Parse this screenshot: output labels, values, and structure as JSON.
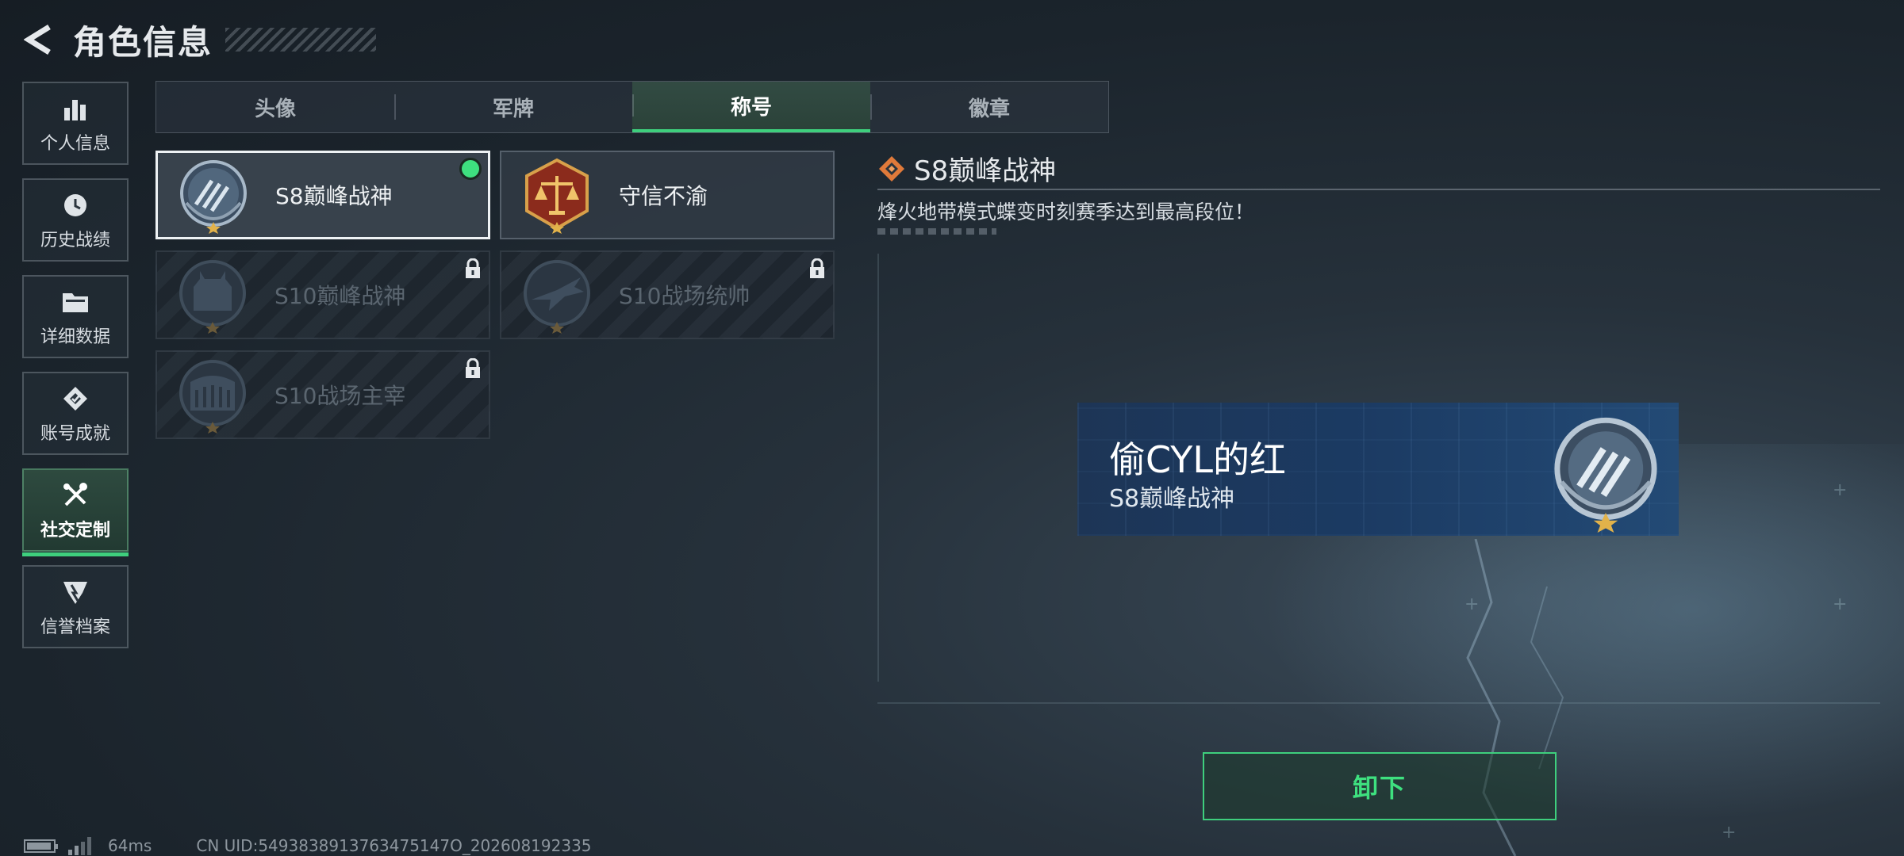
{
  "header": {
    "title": "角色信息"
  },
  "sidebar": {
    "items": [
      {
        "label": "个人信息",
        "icon": "bar-chart-icon"
      },
      {
        "label": "历史战绩",
        "icon": "clock-icon"
      },
      {
        "label": "详细数据",
        "icon": "folder-icon"
      },
      {
        "label": "账号成就",
        "icon": "achievement-icon"
      },
      {
        "label": "社交定制",
        "icon": "tools-icon",
        "active": true
      },
      {
        "label": "信誉档案",
        "icon": "shield-icon"
      }
    ]
  },
  "tabs": [
    {
      "label": "头像"
    },
    {
      "label": "军牌"
    },
    {
      "label": "称号",
      "active": true
    },
    {
      "label": "徽章"
    }
  ],
  "titles": [
    {
      "name": "S8巅峰战神",
      "state": "equipped",
      "emblem": "s8-peak-emblem"
    },
    {
      "name": "守信不渝",
      "state": "owned",
      "emblem": "scales-emblem"
    },
    {
      "name": "S10巅峰战神",
      "state": "locked",
      "emblem": "castle-emblem"
    },
    {
      "name": "S10战场统帅",
      "state": "locked",
      "emblem": "plane-emblem"
    },
    {
      "name": "S10战场主宰",
      "state": "locked",
      "emblem": "colosseum-emblem"
    }
  ],
  "detail": {
    "title": "S8巅峰战神",
    "description": "烽火地带模式蝶变时刻赛季达到最高段位！"
  },
  "preview": {
    "player_name": "偷CYL的红",
    "title": "S8巅峰战神"
  },
  "action": {
    "label": "卸下"
  },
  "status": {
    "ping": "64ms",
    "uid": "CN UID:5493838913763475147O_202608192335"
  },
  "colors": {
    "accent": "#3ecf7d",
    "preview_bg": "#1d3556"
  }
}
